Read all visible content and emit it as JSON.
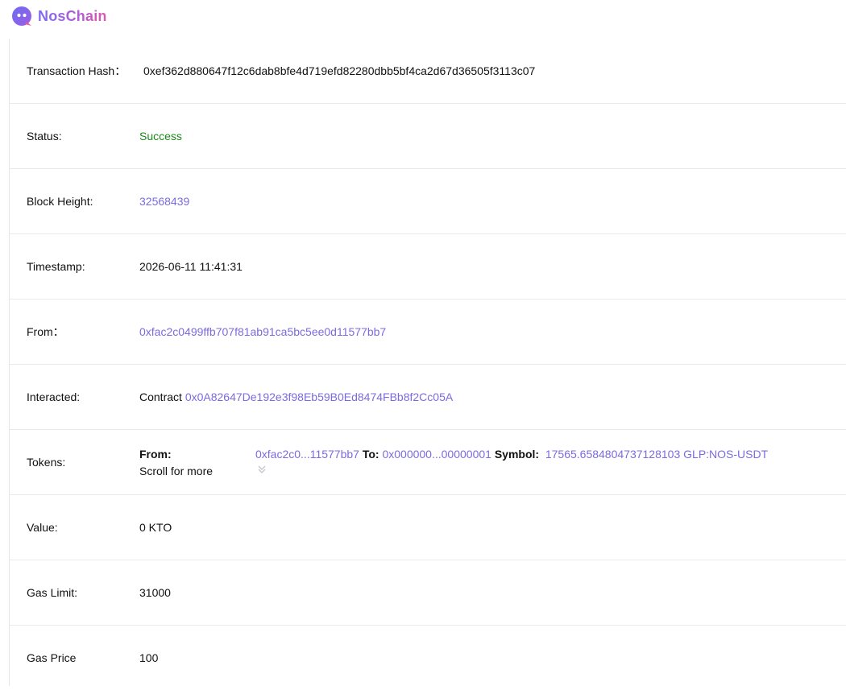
{
  "header": {
    "logo_text": "NosChain",
    "logo_icon": "smiley-face-icon",
    "brand_color": "#7b6be0"
  },
  "tx": {
    "hash_label": "Transaction Hash：",
    "hash_value": "0xef362d880647f12c6dab8bfe4d719efd82280dbb5bf4ca2d67d36505f3113c07",
    "status_label": "Status:",
    "status_value": "Success",
    "block_label": "Block Height:",
    "block_value": "32568439",
    "timestamp_label": "Timestamp:",
    "timestamp_value": "2026-06-11 11:41:31",
    "from_label": "From：",
    "from_value": "0xfac2c0499ffb707f81ab91ca5bc5ee0d11577bb7",
    "interacted_label": "Interacted:",
    "interacted_prefix": "Contract",
    "interacted_value": "0x0A82647De192e3f98Eb59B0Ed8474FBb8f2Cc05A",
    "tokens_label": "Tokens:",
    "tokens_from_label": "From:",
    "tokens_scroll_hint": "Scroll for more",
    "tokens_from_value": "0xfac2c0...11577bb7",
    "tokens_to_label": "To:",
    "tokens_to_value": "0x000000...00000001",
    "tokens_symbol_label": "Symbol:",
    "tokens_amount": "17565.6584804737128103",
    "tokens_symbol": "GLP:NOS-USDT",
    "value_label": "Value:",
    "value_value": "0 KTO",
    "gas_limit_label": "Gas Limit:",
    "gas_limit_value": "31000",
    "gas_price_label": "Gas Price",
    "gas_price_value": "100"
  },
  "colors": {
    "link": "#7b6be0",
    "success": "#1a8a1a",
    "divider": "#e9e9ef"
  }
}
